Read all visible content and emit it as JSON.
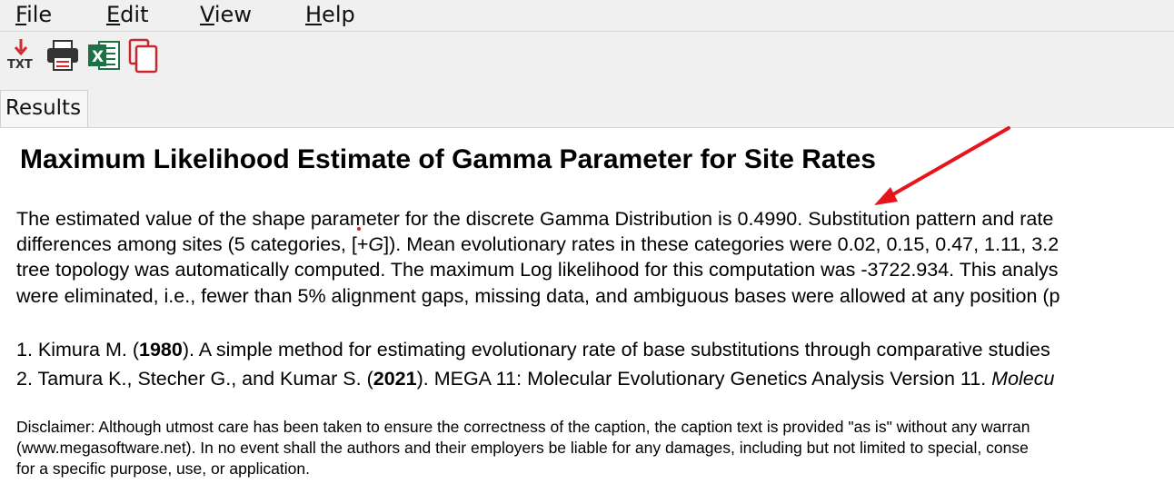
{
  "menu": {
    "file": {
      "accel": "F",
      "rest": "ile"
    },
    "edit": {
      "accel": "E",
      "rest": "dit"
    },
    "view": {
      "accel": "V",
      "rest": "iew"
    },
    "help": {
      "accel": "H",
      "rest": "elp"
    }
  },
  "toolbar": {
    "icons": [
      "export-txt-icon",
      "print-icon",
      "export-excel-icon",
      "copy-icon"
    ],
    "txt_label": "TXT",
    "excel_letter": "X"
  },
  "tabs": {
    "results": "Results"
  },
  "report": {
    "title": "Maximum Likelihood Estimate of Gamma Parameter for Site Rates",
    "p1_l1": "The estimated value of the shape parameter for the discrete Gamma Distribution is 0.4990. Substitution pattern and rate",
    "p1_l2a": "differences among sites (5 categories, [+",
    "p1_l2_g": "G",
    "p1_l2b": "]). Mean evolutionary rates in these categories were 0.02, 0.15, 0.47, 1.11, 3.2",
    "p1_l3": "tree topology was automatically computed. The maximum Log likelihood for this computation was -3722.934. This analys",
    "p1_l4": "were eliminated, i.e., fewer than 5% alignment gaps, missing data, and ambiguous bases were allowed at any position (p",
    "ref1_a": "1. Kimura M. (",
    "ref1_year": "1980",
    "ref1_b": "). A simple method for estimating evolutionary rate of base substitutions through comparative studies",
    "ref2_a": "2. Tamura K., Stecher G., and Kumar S. (",
    "ref2_year": "2021",
    "ref2_b": "). MEGA 11: Molecular Evolutionary Genetics Analysis Version 11. ",
    "ref2_journal": "Molecu",
    "disc_l1": "Disclaimer: Although utmost care has been taken to ensure the correctness of the caption, the caption text is provided \"as is\" without any warran",
    "disc_l2": "(www.megasoftware.net). In no event shall the authors and their employers be liable for any damages, including but not limited to special, conse",
    "disc_l3": "for a specific purpose, use, or application."
  },
  "colors": {
    "annotation_arrow": "#e8141c",
    "excel_green": "#1e7145",
    "copy_red": "#c8282c"
  }
}
